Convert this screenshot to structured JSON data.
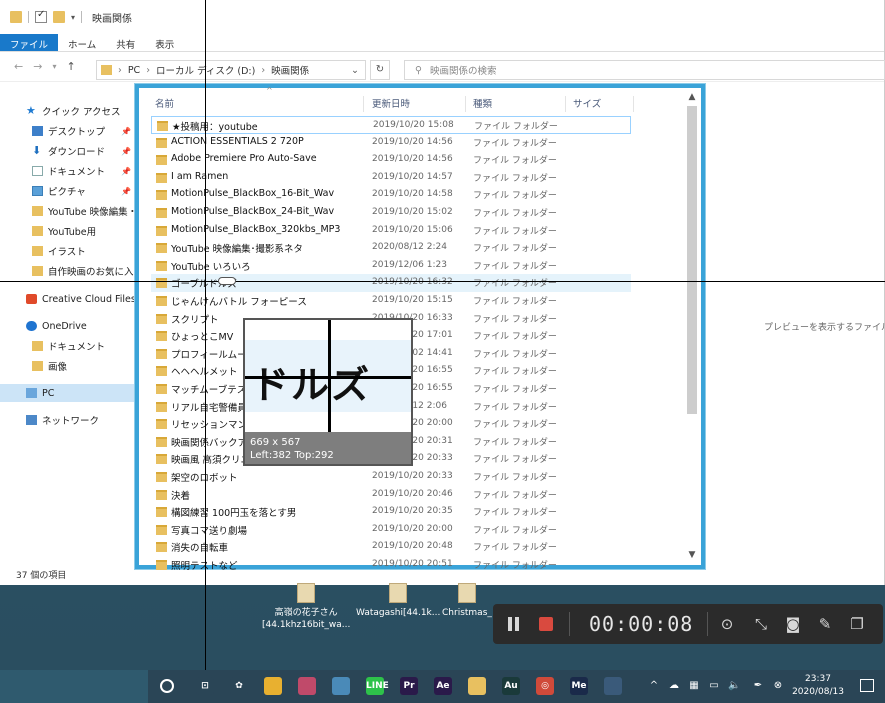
{
  "explorer": {
    "title": "映画関係",
    "ribbon_tabs": [
      "ファイル",
      "ホーム",
      "共有",
      "表示"
    ],
    "breadcrumb": [
      "PC",
      "ローカル ディスク (D:)",
      "映画関係"
    ],
    "search_placeholder": "映画関係の検索",
    "status": "37 個の項目",
    "preview_message": "プレビューを表示するファイルを選"
  },
  "nav": {
    "items": [
      {
        "label": "クイック アクセス",
        "icon": "star-icon"
      },
      {
        "label": "デスクトップ",
        "icon": "desktop-icon",
        "pinned": true
      },
      {
        "label": "ダウンロード",
        "icon": "download-icon",
        "pinned": true
      },
      {
        "label": "ドキュメント",
        "icon": "document-icon",
        "pinned": true
      },
      {
        "label": "ピクチャ",
        "icon": "pictures-icon",
        "pinned": true
      },
      {
        "label": "YouTube 映像編集・撮",
        "icon": "folder-icon"
      },
      {
        "label": "YouTube用",
        "icon": "folder-icon"
      },
      {
        "label": "イラスト",
        "icon": "folder-icon"
      },
      {
        "label": "自作映画のお気に入",
        "icon": "folder-icon"
      },
      {
        "label": "Creative Cloud Files",
        "icon": "creative-cloud-icon"
      },
      {
        "label": "OneDrive",
        "icon": "onedrive-icon"
      },
      {
        "label": "ドキュメント",
        "icon": "folder-icon"
      },
      {
        "label": "画像",
        "icon": "folder-icon"
      },
      {
        "label": "PC",
        "icon": "pc-icon"
      },
      {
        "label": "ネットワーク",
        "icon": "network-icon"
      }
    ]
  },
  "list": {
    "headers": {
      "name": "名前",
      "date": "更新日時",
      "type": "種類",
      "size": "サイズ"
    },
    "rows": [
      {
        "name": "★投稿用：youtube",
        "date": "2019/10/20 15:08",
        "type": "ファイル フォルダー"
      },
      {
        "name": "ACTION ESSENTIALS 2 720P",
        "date": "2019/10/20 14:56",
        "type": "ファイル フォルダー"
      },
      {
        "name": "Adobe Premiere Pro Auto-Save",
        "date": "2019/10/20 14:56",
        "type": "ファイル フォルダー"
      },
      {
        "name": "I am Ramen",
        "date": "2019/10/20 14:57",
        "type": "ファイル フォルダー"
      },
      {
        "name": "MotionPulse_BlackBox_16-Bit_Wav",
        "date": "2019/10/20 14:58",
        "type": "ファイル フォルダー"
      },
      {
        "name": "MotionPulse_BlackBox_24-Bit_Wav",
        "date": "2019/10/20 15:02",
        "type": "ファイル フォルダー"
      },
      {
        "name": "MotionPulse_BlackBox_320kbs_MP3",
        "date": "2019/10/20 15:06",
        "type": "ファイル フォルダー"
      },
      {
        "name": "YouTube 映像編集･撮影系ネタ",
        "date": "2020/08/12 2:24",
        "type": "ファイル フォルダー"
      },
      {
        "name": "YouTube いろいろ",
        "date": "2019/12/06 1:23",
        "type": "ファイル フォルダー"
      },
      {
        "name": "ゴーブルドルズ",
        "date": "2019/10/20 16:32",
        "type": "ファイル フォルダー"
      },
      {
        "name": "じゃんけんバトル フォーピース",
        "date": "2019/10/20 15:15",
        "type": "ファイル フォルダー"
      },
      {
        "name": "スクリプト",
        "date": "2019/10/20 16:33",
        "type": "ファイル フォルダー"
      },
      {
        "name": "ひょっとこMV",
        "date": "2019/10/20 17:01",
        "type": "ファイル フォルダー"
      },
      {
        "name": "プロフィールムービー",
        "date": "2019/10/02 14:41",
        "type": "ファイル フォルダー"
      },
      {
        "name": "ヘヘヘルメット",
        "date": "2019/10/20 16:55",
        "type": "ファイル フォルダー"
      },
      {
        "name": "マッチムーブテスト_A",
        "date": "2019/10/20 16:55",
        "type": "ファイル フォルダー"
      },
      {
        "name": "リアル自宅警備員",
        "date": "2020/08/12 2:06",
        "type": "ファイル フォルダー"
      },
      {
        "name": "リセッションマン",
        "date": "2019/10/20 20:00",
        "type": "ファイル フォルダー"
      },
      {
        "name": "映画関係バックアップ",
        "date": "2019/10/20 20:31",
        "type": "ファイル フォルダー"
      },
      {
        "name": "映画風 高須クリニック",
        "date": "2019/10/20 20:33",
        "type": "ファイル フォルダー"
      },
      {
        "name": "架空のロボット",
        "date": "2019/10/20 20:33",
        "type": "ファイル フォルダー"
      },
      {
        "name": "決着",
        "date": "2019/10/20 20:46",
        "type": "ファイル フォルダー"
      },
      {
        "name": "構図練習 100円玉を落とす男",
        "date": "2019/10/20 20:35",
        "type": "ファイル フォルダー"
      },
      {
        "name": "写真コマ送り劇場",
        "date": "2019/10/20 20:00",
        "type": "ファイル フォルダー"
      },
      {
        "name": "消失の自転車",
        "date": "2019/10/20 20:48",
        "type": "ファイル フォルダー"
      },
      {
        "name": "照明テストなど",
        "date": "2019/10/20 20:51",
        "type": "ファイル フォルダー"
      }
    ]
  },
  "magnifier": {
    "zoom_text": "ドルズ",
    "size_readout": "669 x 567",
    "position_readout": "Left:382 Top:292"
  },
  "desktop_icons": [
    {
      "label_line1": "高嶺の花子さん",
      "label_line2": "[44.1khz16bit_wa..."
    },
    {
      "label_line1": "Watagashi[44.1k...",
      "label_line2": ""
    },
    {
      "label_line1": "Christmas_",
      "label_line2": ""
    }
  ],
  "recorder": {
    "timer": "00:00:08",
    "tools": [
      "screenshot-region-icon",
      "fit-icon",
      "camera-icon",
      "pen-icon",
      "window-icon"
    ]
  },
  "taskbar": {
    "apps": [
      {
        "name": "task-view-icon",
        "label": "⊡",
        "color": "#2a4556"
      },
      {
        "name": "palette-icon",
        "label": "✿",
        "color": "#2a4556"
      },
      {
        "name": "chrome-icon",
        "label": "",
        "color": "#e8b030"
      },
      {
        "name": "edge-icon",
        "label": "",
        "color": "#c04a6a"
      },
      {
        "name": "paint-icon",
        "label": "",
        "color": "#4a8ab8"
      },
      {
        "name": "line-icon",
        "label": "LINE",
        "color": "#2ec24a"
      },
      {
        "name": "premiere-icon",
        "label": "Pr",
        "color": "#2a1a4a"
      },
      {
        "name": "after-effects-icon",
        "label": "Ae",
        "color": "#2a1a4a"
      },
      {
        "name": "file-explorer-icon",
        "label": "",
        "color": "#e8c060"
      },
      {
        "name": "audition-icon",
        "label": "Au",
        "color": "#1a3a3a"
      },
      {
        "name": "recorder-app-icon",
        "label": "◎",
        "color": "#d04a3a"
      },
      {
        "name": "media-encoder-icon",
        "label": "Me",
        "color": "#1a2a4a"
      },
      {
        "name": "video-app-icon",
        "label": "",
        "color": "#3a5a7a"
      }
    ],
    "time": "23:37",
    "date": "2020/08/13"
  },
  "colors": {
    "capture_border": "#3aa3d8",
    "ribbon_file_tab": "#1979ca",
    "stop_button": "#d94a3f",
    "folder": "#e8c060"
  }
}
